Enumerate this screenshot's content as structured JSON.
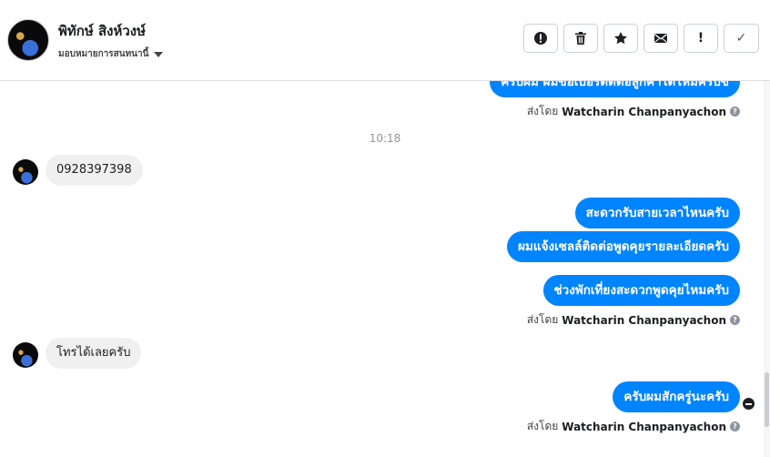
{
  "header": {
    "contact_name": "พิทักษ์ สิงห์วงษ์",
    "assign_label": "มอบหมายการสนทนานี้"
  },
  "toolbar": {
    "buttons": [
      {
        "name": "report",
        "label": "!",
        "icon": "alert-circle-icon"
      },
      {
        "name": "delete",
        "label": "",
        "icon": "trash-icon"
      },
      {
        "name": "star",
        "label": "",
        "icon": "star-icon"
      },
      {
        "name": "unread",
        "label": "",
        "icon": "envelope-icon"
      },
      {
        "name": "spam",
        "label": "!",
        "icon": "exclamation-icon"
      },
      {
        "name": "done",
        "label": "✓",
        "icon": "check-icon"
      }
    ]
  },
  "thread": {
    "top_cut_message": "ครับผม ผมขอเบอร์ติดต่อลูกค้าได้ไหมครับข",
    "sent_by_prefix": "ส่งโดย",
    "agent_name": "Watcharin Chanpanyachon",
    "time_label": "10:18",
    "in_phone": "0928397398",
    "out_1": "สะดวกรับสายเวลาไหนครับ",
    "out_2": "ผมแจ้งเซลล์ติดต่อพูดคุยรายละเอียดครับ",
    "out_3": "ช่วงพักเที่ยงสะดวกพูดคุยไหมครับ",
    "in_2": "โทรได้เลยครับ",
    "out_4": "ครับผมสักครู่นะครับ"
  },
  "colors": {
    "accent": "#0084ff",
    "incoming_bg": "#f1f0f0"
  }
}
